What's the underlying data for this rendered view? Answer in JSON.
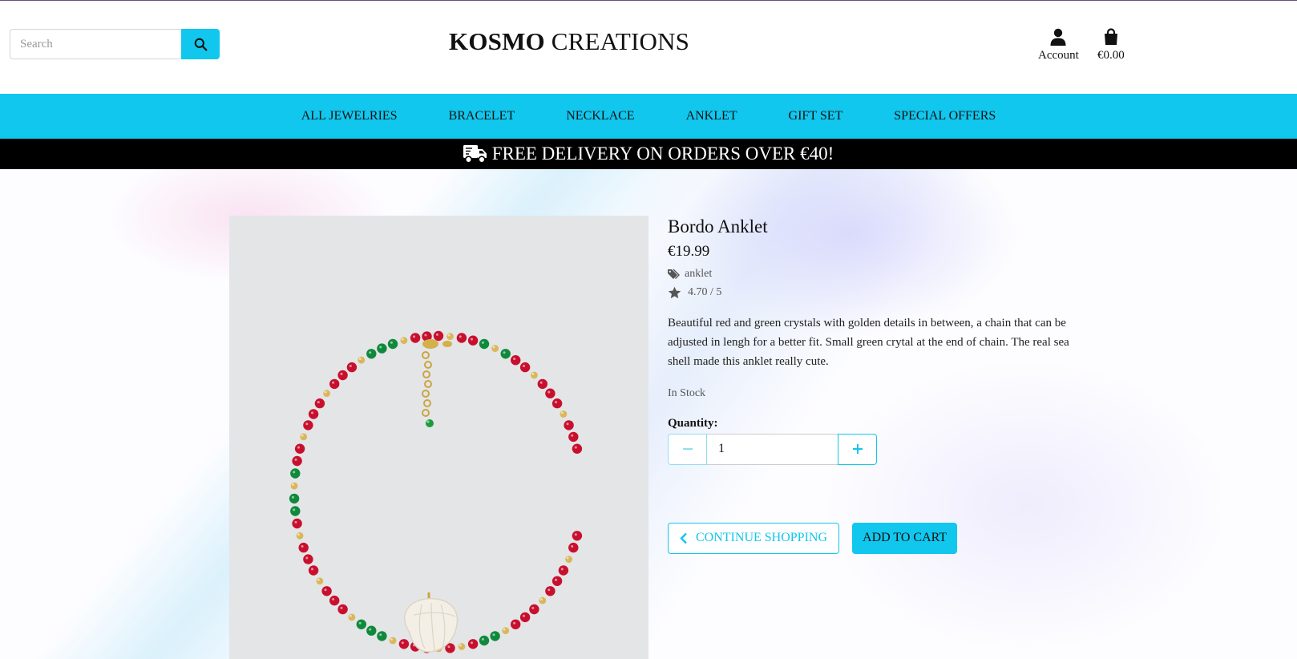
{
  "header": {
    "search_placeholder": "Search",
    "brand_bold": "KOSMO",
    "brand_light": "CREATIONS",
    "account_label": "Account",
    "cart_total": "€0.00"
  },
  "nav": {
    "items": [
      "ALL JEWELRIES",
      "BRACELET",
      "NECKLACE",
      "ANKLET",
      "GIFT SET",
      "SPECIAL OFFERS"
    ]
  },
  "promo": {
    "text": "FREE DELIVERY ON ORDERS OVER €40!"
  },
  "product": {
    "title": "Bordo Anklet",
    "price": "€19.99",
    "category": "anklet",
    "rating": "4.70 / 5",
    "description": "Beautiful red and green crystals with golden details in between, a chain that can be adjusted in lengh for a better fit. Small green crytal at the end of chain. The real sea shell made this anklet really cute.",
    "stock": "In Stock",
    "quantity_label": "Quantity:",
    "quantity_value": "1"
  },
  "actions": {
    "continue_label": "CONTINUE SHOPPING",
    "add_to_cart_label": "ADD TO CART"
  },
  "colors": {
    "accent": "#11c7ee",
    "promo_bg": "#000000",
    "photo_bg": "#e4e5e7"
  },
  "icons": {
    "search": "search-icon",
    "account": "user-icon",
    "cart": "shopping-bag-icon",
    "promo": "truck-icon",
    "category": "tags-icon",
    "rating": "star-icon",
    "minus": "minus-icon",
    "plus": "plus-icon",
    "back": "chevron-left-icon"
  }
}
